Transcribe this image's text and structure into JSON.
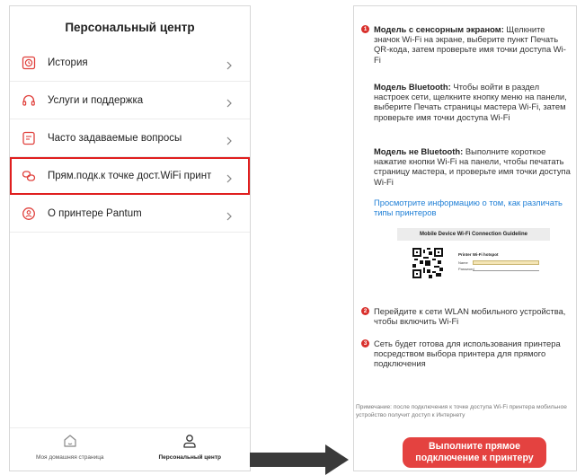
{
  "left_screen": {
    "title": "Персональный центр",
    "menu": [
      {
        "label": "История",
        "icon": "history-icon"
      },
      {
        "label": "Услуги и поддержка",
        "icon": "headset-icon"
      },
      {
        "label": "Часто задаваемые вопросы",
        "icon": "faq-icon"
      },
      {
        "label": "Прям.подк.к точке дост.WiFi принт",
        "icon": "wifi-direct-icon",
        "highlighted": true
      },
      {
        "label": "О принтере Pantum",
        "icon": "info-person-icon"
      }
    ],
    "bottom_nav": [
      {
        "label": "Моя домашняя страница",
        "icon": "home-icon"
      },
      {
        "label": "Персональный центр",
        "icon": "person-icon",
        "active": true
      }
    ]
  },
  "right_screen": {
    "step1": {
      "number": "1",
      "touch_bold": "Модель с сенсорным экраном:",
      "touch_text": " Щелкните значок Wi-Fi на экране, выберите пункт Печать QR-кода, затем проверьте имя точки доступа Wi-Fi",
      "bt_bold": "Модель Bluetooth:",
      "bt_text": " Чтобы войти в раздел настроек сети, щелкните кнопку меню на панели, выберите Печать страницы мастера Wi-Fi, затем проверьте имя точки доступа Wi-Fi",
      "nobt_bold": "Модель не Bluetooth:",
      "nobt_text": " Выполните короткое нажатие кнопки Wi-Fi на панели, чтобы печатать страницу мастера, и проверьте имя точки доступа Wi-Fi"
    },
    "link": "Просмотрите информацию о том, как различать типы принтеров",
    "guide": {
      "title": "Mobile Device Wi-Fi Connection Guideline",
      "hotspot_label": "Printer Wi-Fi hotspot",
      "name_label": "Name",
      "password_label": "Password"
    },
    "step2": {
      "number": "2",
      "text": "Перейдите к сети WLAN мобильного устройства, чтобы включить Wi-Fi"
    },
    "step3": {
      "number": "3",
      "text": "Сеть будет готова для использования принтера посредством выбора принтера для прямого подключения"
    },
    "note": "Примечание: после подключения к точке доступа Wi-Fi принтера мобильное устройство получит доступ к Интернету",
    "cta": "Выполните прямое подключение к принтеру"
  },
  "colors": {
    "accent_red": "#e01f1f",
    "cta_red": "#e44240",
    "link_blue": "#1f7fd6",
    "arrow_dark": "#3a3a3a"
  }
}
